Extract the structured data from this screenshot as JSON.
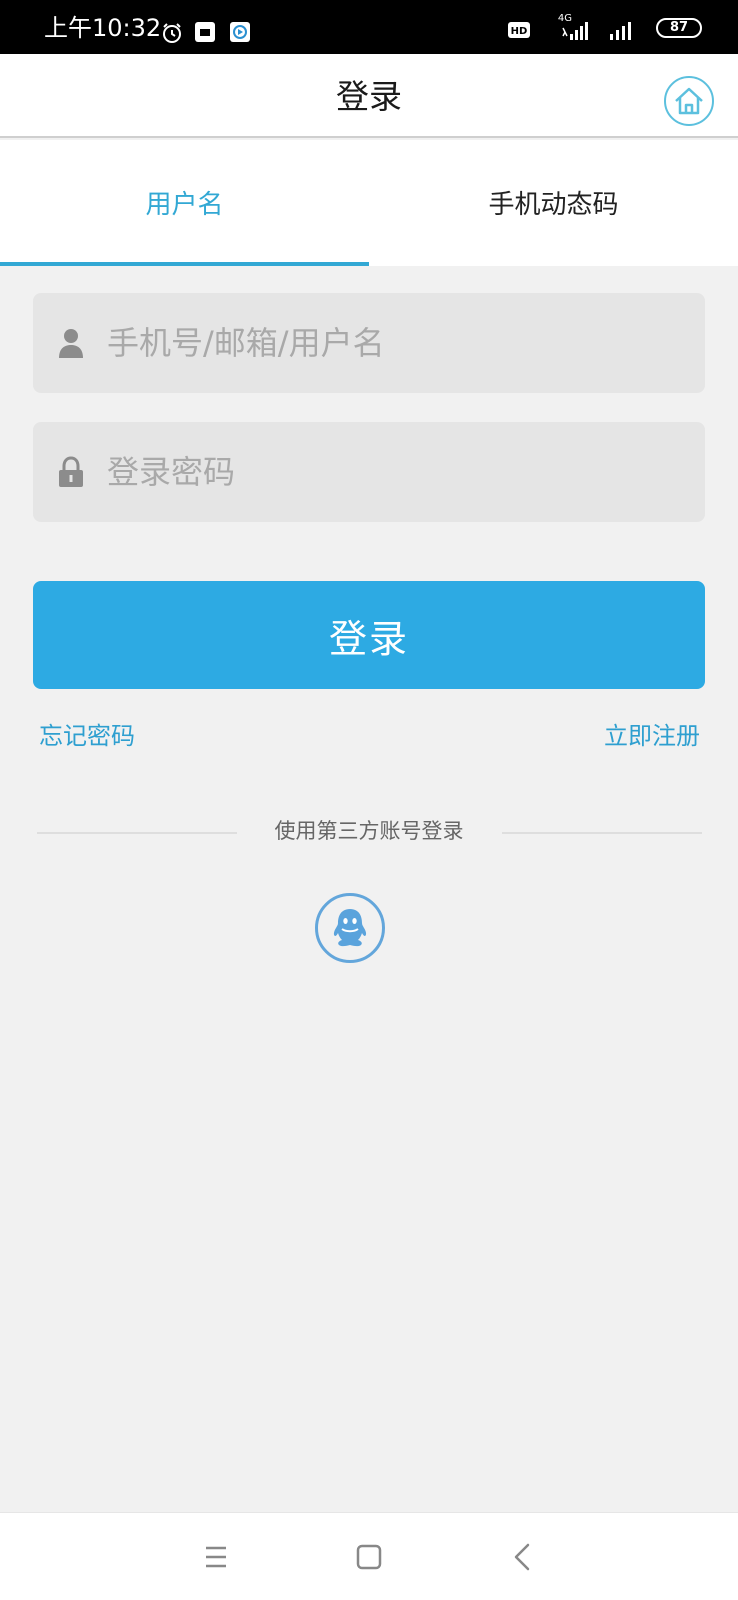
{
  "status_bar": {
    "time": "上午10:32",
    "network": "4G",
    "hd": "HD",
    "battery": "87"
  },
  "header": {
    "title": "登录",
    "home_icon": "home-icon"
  },
  "tabs": [
    {
      "label": "用户名",
      "active": true
    },
    {
      "label": "手机动态码",
      "active": false
    }
  ],
  "form": {
    "username_placeholder": "手机号/邮箱/用户名",
    "password_placeholder": "登录密码",
    "submit_label": "登录"
  },
  "links": {
    "forgot_password": "忘记密码",
    "register": "立即注册"
  },
  "third_party": {
    "label": "使用第三方账号登录",
    "providers": [
      "qq-icon"
    ]
  },
  "colors": {
    "accent": "#2daae3",
    "link": "#2e9fd0",
    "background": "#f1f1f1",
    "field": "#e5e5e5"
  }
}
